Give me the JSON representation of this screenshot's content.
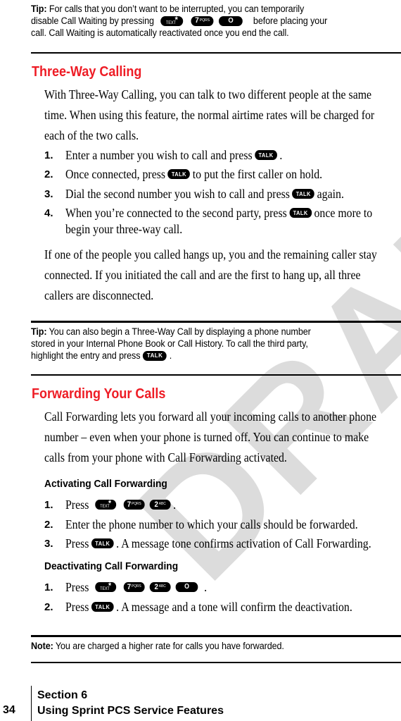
{
  "watermark": "DRAFT",
  "tip1": {
    "label": "Tip:",
    "text_a": "For calls that you don’t want to be interrupted, you can temporarily",
    "text_b": "disable Call Waiting by pressing",
    "text_c": "before placing your",
    "text_d": "call. Call Waiting is automatically reactivated once you end the call."
  },
  "keys": {
    "talk": "TALK",
    "star_symbol": "*",
    "star_label": "TEXT",
    "seven": "7",
    "seven_sub": "PQRS",
    "two": "2",
    "two_sub": "ABC",
    "zero": "O"
  },
  "three_way": {
    "heading": "Three-Way Calling",
    "intro": "With Three-Way Calling, you can talk to two different people at the same time. When using this feature, the normal airtime rates will be charged for each of the two calls.",
    "steps": [
      {
        "num": "1.",
        "before": "Enter a number you wish to call and press",
        "after": "."
      },
      {
        "num": "2.",
        "before": "Once connected, press",
        "after": "to put the first caller on hold."
      },
      {
        "num": "3.",
        "before": "Dial the second number you wish to call and press",
        "after": "again."
      },
      {
        "num": "4.",
        "before": "When you’re connected to the second party, press",
        "after": "once more to",
        "cont": "begin your three-way call."
      }
    ],
    "outro": "If one of the people you called hangs up, you and the remaining caller stay connected. If you initiated the call and are the first to hang up, all three callers are disconnected."
  },
  "tip2": {
    "label": "Tip:",
    "text_a": "You can also begin a Three-Way Call by displaying a phone number",
    "text_b": "stored in your Internal Phone Book or Call History. To call the third party,",
    "text_c": "highlight the entry and press",
    "text_d": "."
  },
  "forwarding": {
    "heading": "Forwarding Your Calls",
    "intro": "Call Forwarding lets you forward all your incoming calls to another phone number – even when your phone is turned off. You can continue to make calls from your phone with Call Forwarding activated.",
    "activating": {
      "title": "Activating Call Forwarding",
      "steps": [
        {
          "num": "1.",
          "before": "Press",
          "after": "."
        },
        {
          "num": "2.",
          "text": "Enter the phone number to which your calls should be forwarded."
        },
        {
          "num": "3.",
          "before": "Press",
          "after": ". A message tone confirms activation of Call Forwarding."
        }
      ]
    },
    "deactivating": {
      "title": "Deactivating Call Forwarding",
      "steps": [
        {
          "num": "1.",
          "before": "Press",
          "after": "."
        },
        {
          "num": "2.",
          "before": "Press",
          "after": ". A message and a tone will confirm the deactivation."
        }
      ]
    }
  },
  "note": {
    "label": "Note:",
    "text": "You are charged a higher rate for calls you have forwarded."
  },
  "footer": {
    "page_number": "34",
    "section": "Section 6",
    "section_title": "Using Sprint PCS Service Features"
  }
}
